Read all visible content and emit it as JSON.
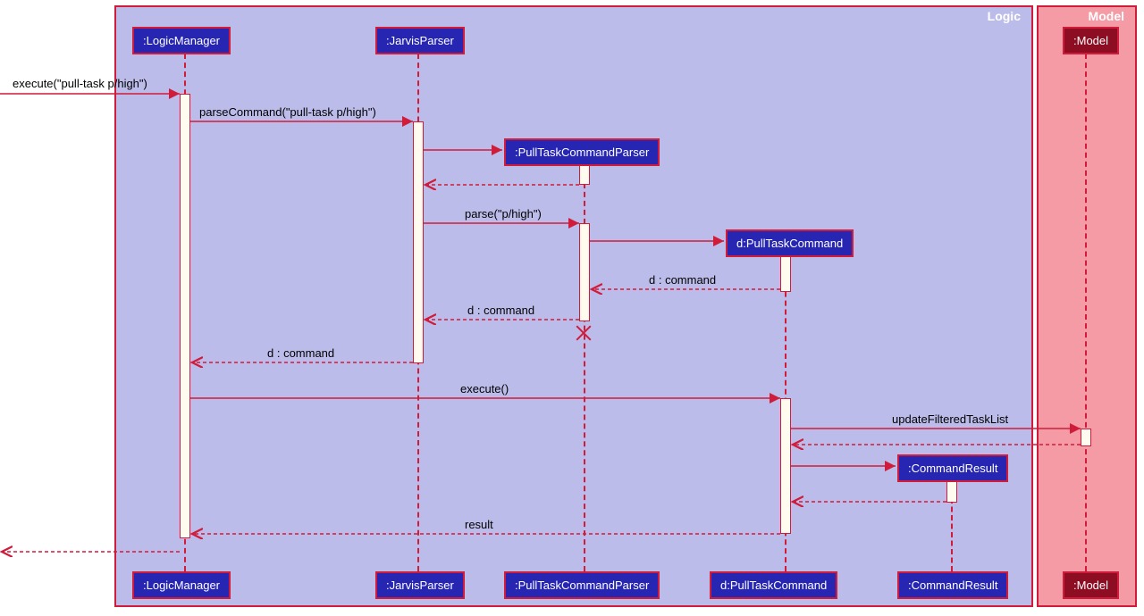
{
  "frames": {
    "logic": "Logic",
    "model": "Model"
  },
  "participants": {
    "logicManager": ":LogicManager",
    "jarvisParser": ":JarvisParser",
    "pullTaskCommandParser": ":PullTaskCommandParser",
    "pullTaskCommand": "d:PullTaskCommand",
    "commandResult": ":CommandResult",
    "model": ":Model"
  },
  "messages": {
    "execute_in": "execute(\"pull-task p/high\")",
    "parseCommand": "parseCommand(\"pull-task p/high\")",
    "parse": "parse(\"p/high\")",
    "d_command_1": "d : command",
    "d_command_2": "d : command",
    "d_command_3": "d : command",
    "execute": "execute()",
    "updateFilteredTaskList": "updateFilteredTaskList",
    "result": "result"
  }
}
